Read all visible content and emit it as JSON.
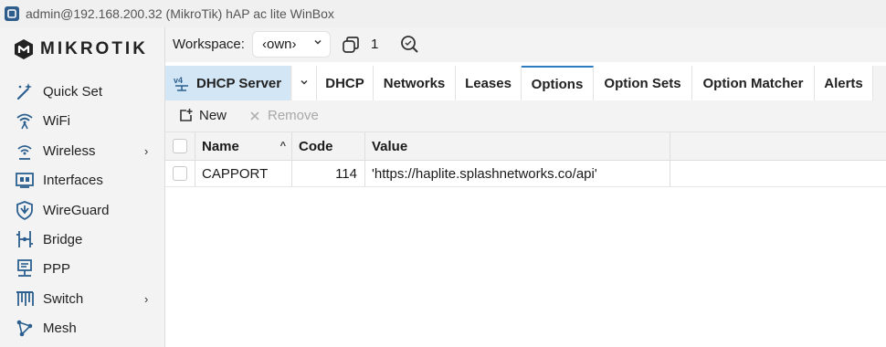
{
  "window": {
    "title": "admin@192.168.200.32 (MikroTik) hAP ac lite WinBox"
  },
  "brand": {
    "logo_text": "MIKROTIK",
    "accent_color": "#2e7bbf",
    "tab_highlight_color": "#d3e6f5"
  },
  "sidebar": {
    "items": [
      {
        "label": "Quick Set",
        "icon": "wand-icon",
        "submenu": false
      },
      {
        "label": "WiFi",
        "icon": "wifi-icon",
        "submenu": false
      },
      {
        "label": "Wireless",
        "icon": "wireless-icon",
        "submenu": true,
        "chevron": "›"
      },
      {
        "label": "Interfaces",
        "icon": "interfaces-icon",
        "submenu": false
      },
      {
        "label": "WireGuard",
        "icon": "wireguard-icon",
        "submenu": false
      },
      {
        "label": "Bridge",
        "icon": "bridge-icon",
        "submenu": false
      },
      {
        "label": "PPP",
        "icon": "ppp-icon",
        "submenu": false
      },
      {
        "label": "Switch",
        "icon": "switch-icon",
        "submenu": true,
        "chevron": "›"
      },
      {
        "label": "Mesh",
        "icon": "mesh-icon",
        "submenu": false
      }
    ]
  },
  "workspace": {
    "label": "Workspace:",
    "selected": "‹own›",
    "window_count": "1"
  },
  "tabs": {
    "main": "DHCP Server",
    "dropdown": "⌄",
    "items": [
      "DHCP",
      "Networks",
      "Leases",
      "Options",
      "Option Sets",
      "Option Matcher",
      "Alerts"
    ],
    "active": "Options"
  },
  "toolbar": {
    "new_label": "New",
    "remove_label": "Remove"
  },
  "table": {
    "columns": [
      "Name",
      "Code",
      "Value"
    ],
    "sort_indicator": "^",
    "rows": [
      {
        "name": "CAPPORT",
        "code": "114",
        "value": "'https://haplite.splashnetworks.co/api'"
      }
    ]
  }
}
